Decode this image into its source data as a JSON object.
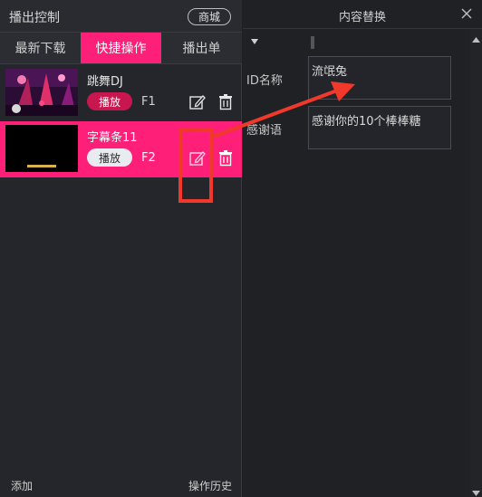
{
  "left_panel": {
    "title": "播出控制",
    "mall_button": "商城",
    "tabs": [
      {
        "label": "最新下载",
        "active": false
      },
      {
        "label": "快捷操作",
        "active": true
      },
      {
        "label": "播出单",
        "active": false
      }
    ],
    "items": [
      {
        "name": "跳舞DJ",
        "play_label": "播放",
        "hotkey": "F1",
        "selected": false,
        "edit_icon": "edit-icon",
        "delete_icon": "trash-icon"
      },
      {
        "name": "字幕条11",
        "play_label": "播放",
        "hotkey": "F2",
        "selected": true,
        "edit_icon": "edit-icon",
        "delete_icon": "trash-icon"
      }
    ],
    "footer": {
      "add_label": "添加",
      "history_label": "操作历史"
    }
  },
  "right_panel": {
    "title": "内容替换",
    "close_icon": "close-icon",
    "collapse_icon": "triangle-down-icon",
    "fields": [
      {
        "label": "ID名称",
        "value": "流氓兔"
      },
      {
        "label": "感谢语",
        "value": "感谢你的10个棒棒糖"
      }
    ]
  },
  "annotation": {
    "color": "#f0392b",
    "shapes": [
      "highlight-rectangle",
      "arrow"
    ]
  },
  "colors": {
    "accent": "#fe1f78",
    "play_button": "#c8174f",
    "panel_bg": "#25262b"
  }
}
